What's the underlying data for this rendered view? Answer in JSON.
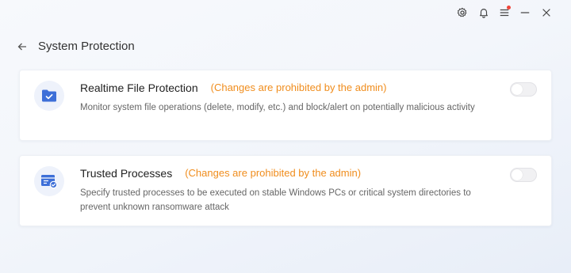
{
  "window": {
    "settings_icon": "gear-icon",
    "notification_icon": "bell-icon",
    "menu_icon": "hamburger-icon",
    "minimize_icon": "minimize-icon",
    "close_icon": "close-icon",
    "notification_dot_color": "#f0453a"
  },
  "header": {
    "back_icon": "arrow-left-icon",
    "title": "System Protection"
  },
  "cards": [
    {
      "icon": "folder-check-icon",
      "title": "Realtime File Protection",
      "notice": "(Changes are prohibited by the admin)",
      "description": "Monitor system file operations (delete, modify, etc.) and block/alert on potentially malicious activity",
      "toggle_on": false,
      "toggle_disabled": true
    },
    {
      "icon": "trusted-window-icon",
      "title": "Trusted Processes",
      "notice": "(Changes are prohibited by the admin)",
      "description": "Specify trusted processes to be executed on stable Windows PCs or critical system directories to prevent unknown ransomware attack",
      "toggle_on": false,
      "toggle_disabled": true
    }
  ],
  "colors": {
    "accent": "#3d6fd8",
    "warning": "#f08d1d"
  }
}
